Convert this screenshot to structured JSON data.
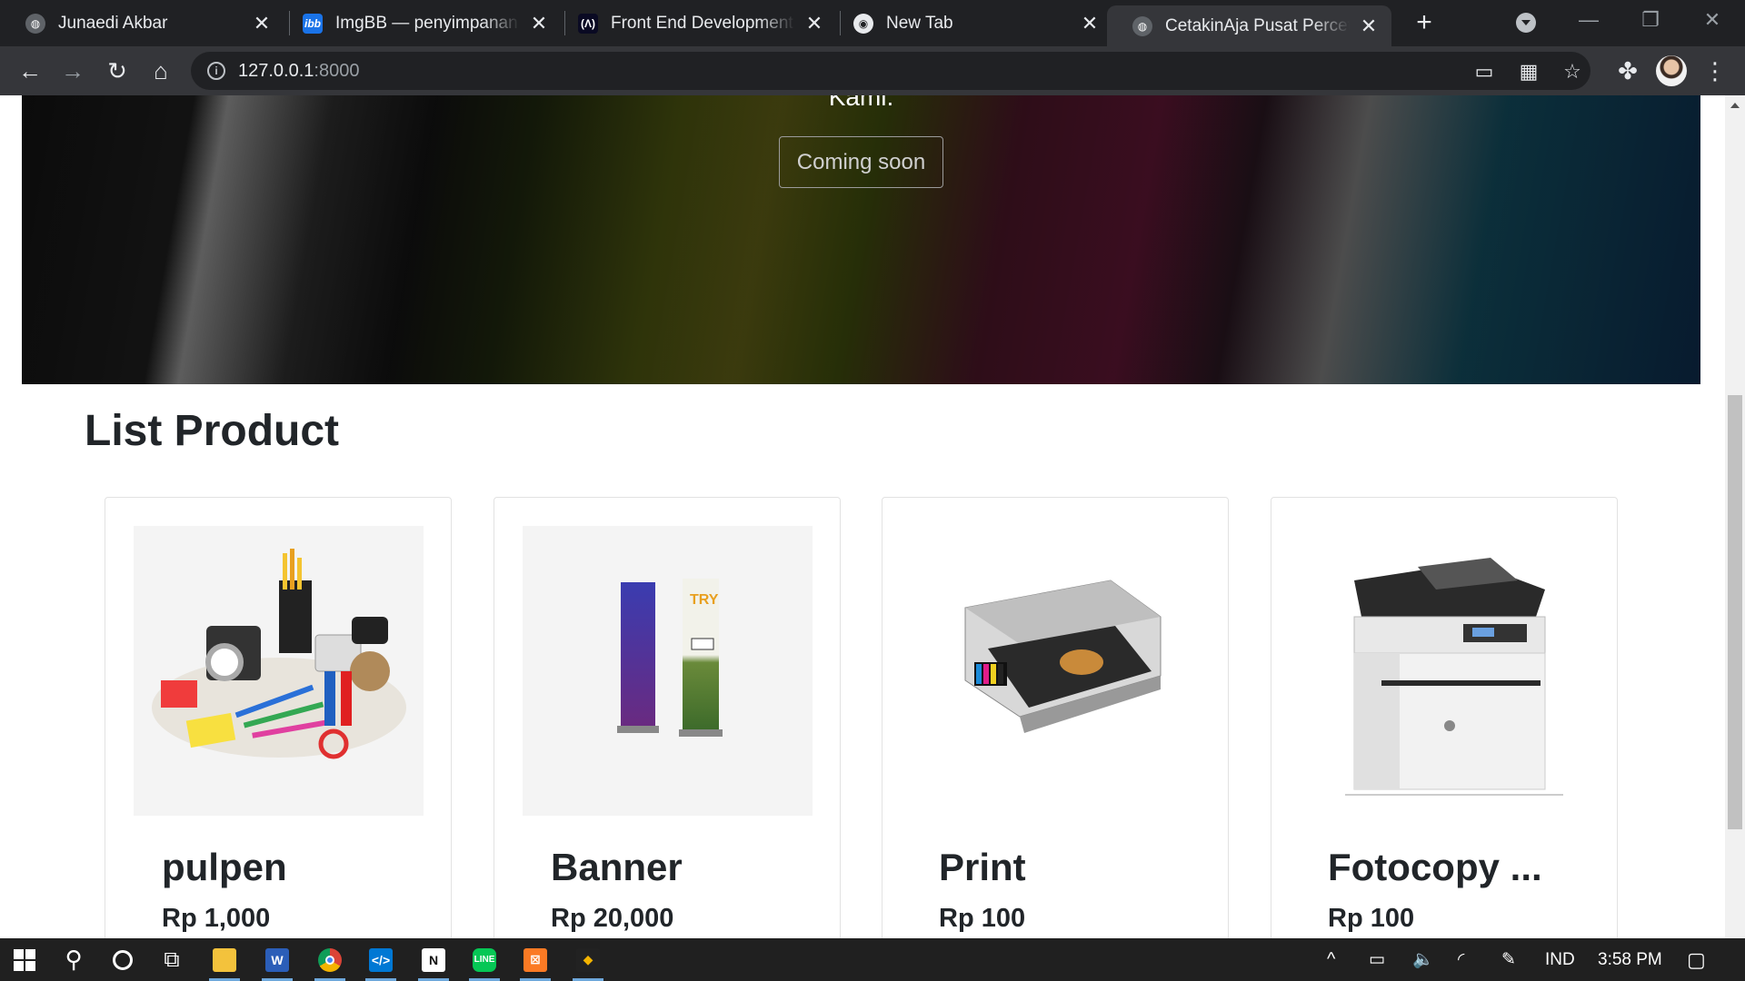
{
  "browser": {
    "tabs": [
      {
        "title": "Junaedi Akbar",
        "icon": "globe-icon",
        "active": false
      },
      {
        "title": "ImgBB — penyimpanan gambar",
        "icon": "imgbb-icon",
        "active": false
      },
      {
        "title": "Front End Development Libraries",
        "icon": "freecodecamp-icon",
        "active": false
      },
      {
        "title": "New Tab",
        "icon": "chrome-icon",
        "active": false
      },
      {
        "title": "CetakinAja Pusat Percetakan",
        "icon": "globe-icon",
        "active": true
      }
    ],
    "address": {
      "host": "127.0.0.1",
      "port": ":8000"
    }
  },
  "page": {
    "hero_text": "Kami.",
    "hero_button": "Coming soon",
    "section_title": "List Product",
    "products": [
      {
        "name": "pulpen",
        "price": "Rp 1,000"
      },
      {
        "name": "Banner",
        "price": "Rp 20,000"
      },
      {
        "name": "Print",
        "price": "Rp 100"
      },
      {
        "name": "Fotocopy ...",
        "price": "Rp 100"
      }
    ]
  },
  "taskbar": {
    "language": "IND",
    "time": "3:58 PM"
  },
  "colors": {
    "chrome_dark": "#202124",
    "chrome_toolbar": "#35363a",
    "text_dark": "#212529",
    "taskbar": "#202020"
  }
}
